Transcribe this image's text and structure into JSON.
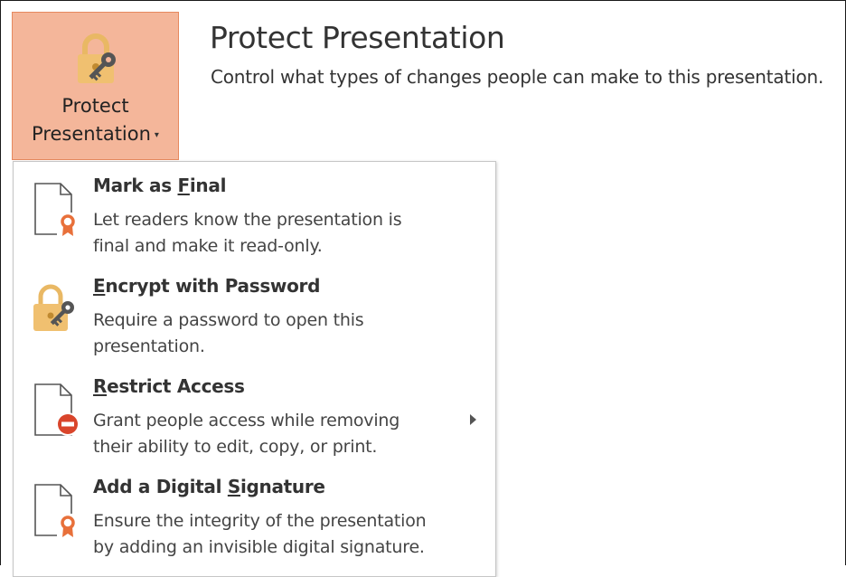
{
  "protect_button": {
    "line1": "Protect",
    "line2": "Presentation",
    "caret": "▾",
    "icon": "lock-key-icon"
  },
  "header": {
    "title": "Protect Presentation",
    "description": "Control what types of changes people can make to this presentation."
  },
  "menu": {
    "items": [
      {
        "title_pre": "Mark as ",
        "title_key": "F",
        "title_post": "inal",
        "line1": "Let readers know the presentation is",
        "line2": "final and make it read-only.",
        "icon": "document-ribbon-icon"
      },
      {
        "title_pre": "",
        "title_key": "E",
        "title_post": "ncrypt with Password",
        "line1": "Require a password to open this",
        "line2": "presentation.",
        "icon": "lock-key-icon"
      },
      {
        "title_pre": "",
        "title_key": "R",
        "title_post": "estrict Access",
        "line1": "Grant people access while removing",
        "line2": "their ability to edit, copy, or print.",
        "icon": "document-no-entry-icon",
        "has_submenu": true
      },
      {
        "title_pre": "Add a Digital ",
        "title_key": "S",
        "title_post": "ignature",
        "line1": "Ensure the integrity of the presentation",
        "line2": "by adding an invisible digital signature.",
        "icon": "document-ribbon-icon"
      }
    ]
  },
  "colors": {
    "button_bg": "#f4b69a",
    "button_border": "#e6895f",
    "lock_gold": "#f0c070",
    "ribbon_orange": "#e8703a",
    "no_entry_red": "#d9452b"
  }
}
